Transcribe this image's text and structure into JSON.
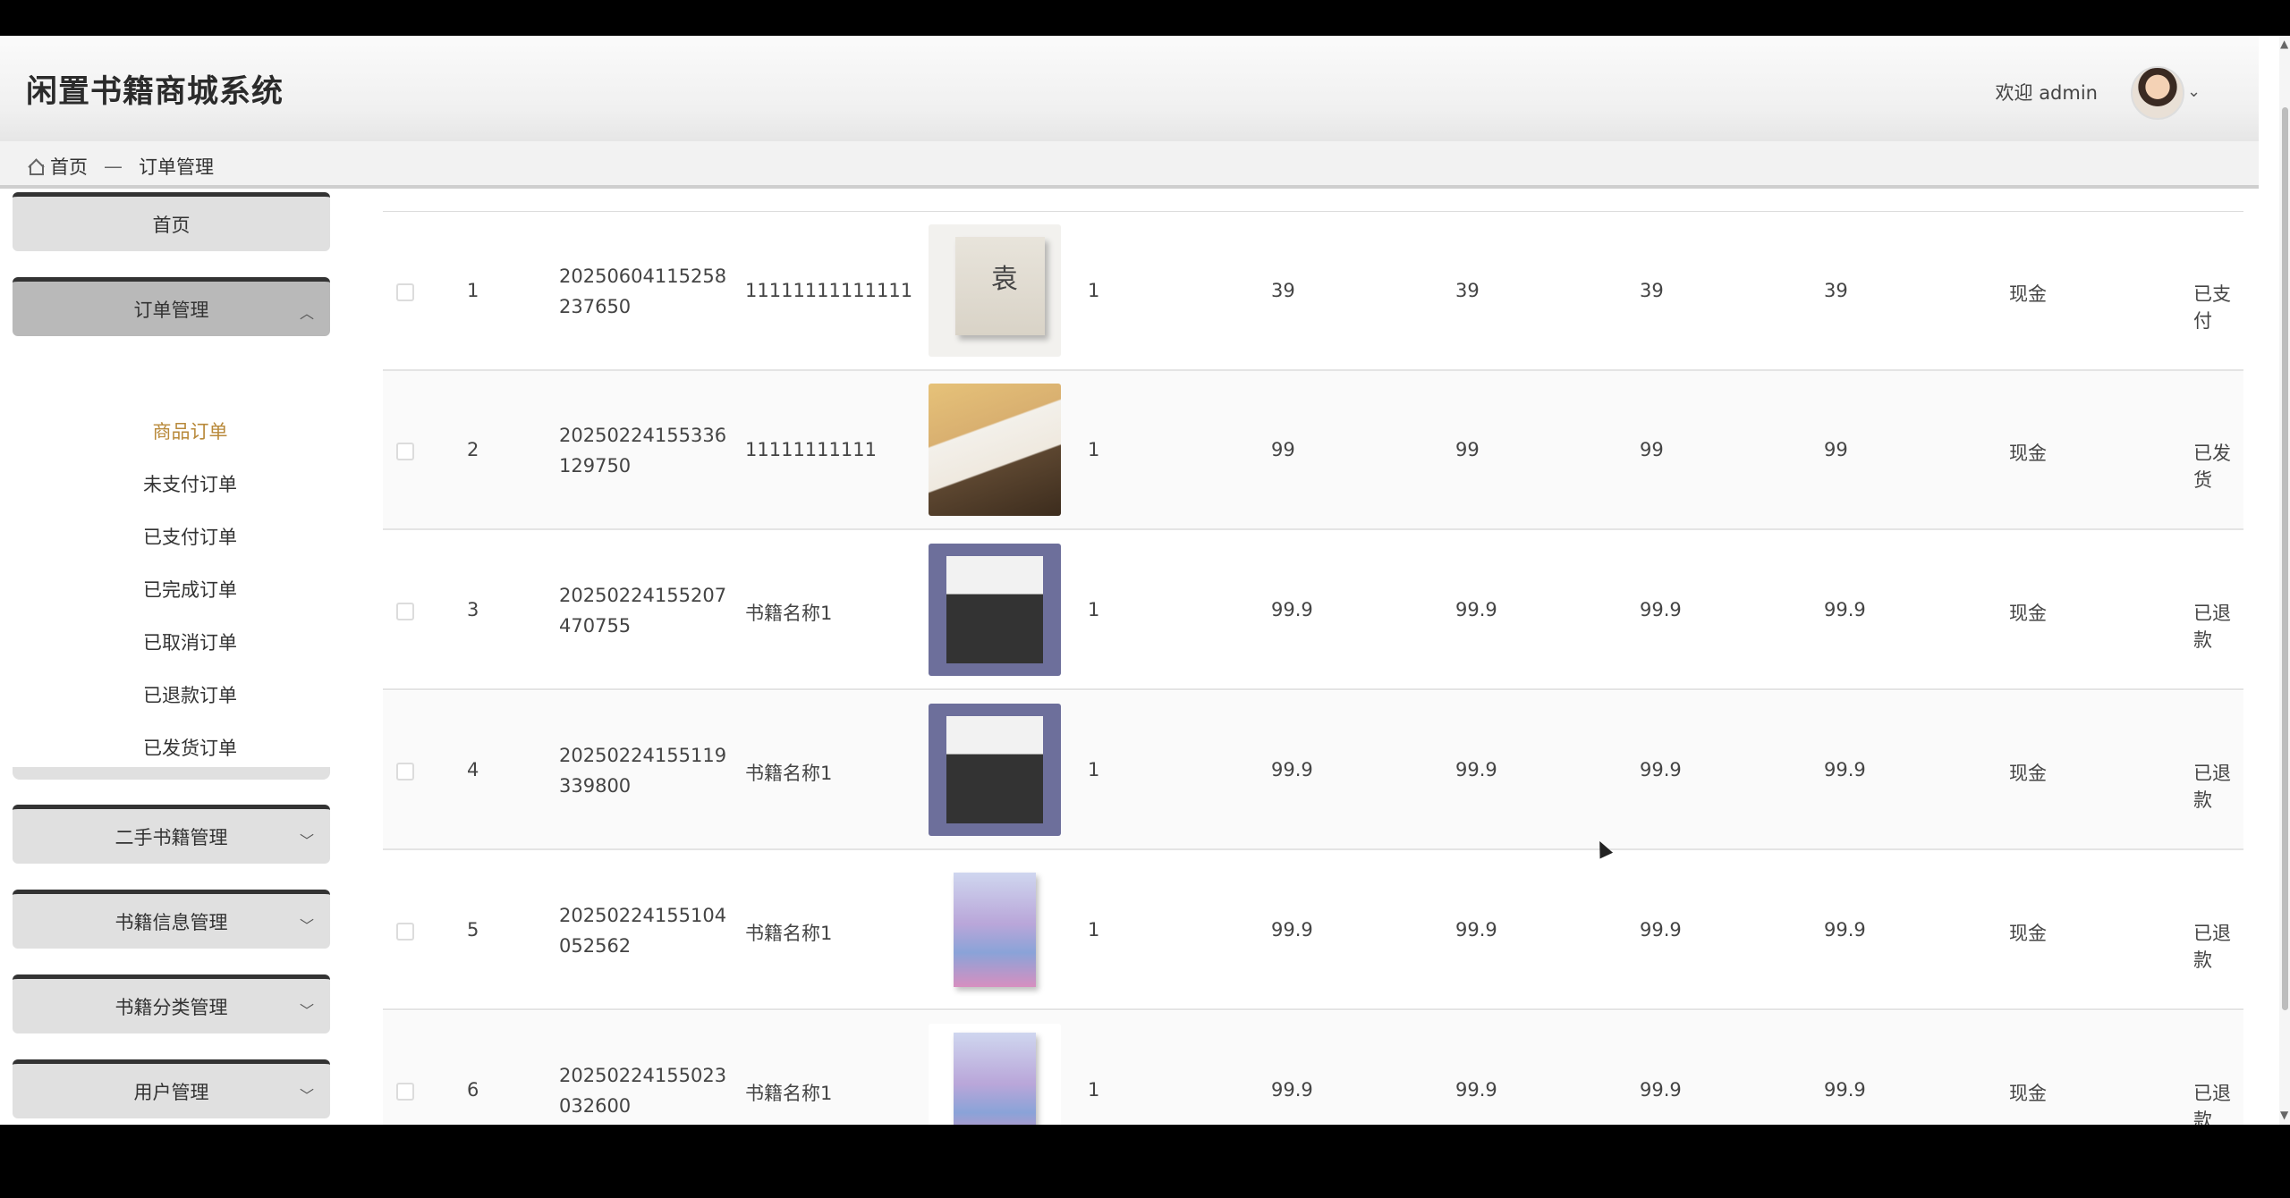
{
  "header": {
    "title": "闲置书籍商城系统",
    "welcome": "欢迎 admin"
  },
  "breadcrumb": {
    "home": "首页",
    "separator": "—",
    "current": "订单管理"
  },
  "sidebar": {
    "home": "首页",
    "order_mgmt": "订单管理",
    "order_sub": [
      "商品订单",
      "未支付订单",
      "已支付订单",
      "已完成订单",
      "已取消订单",
      "已退款订单",
      "已发货订单"
    ],
    "secondhand": "二手书籍管理",
    "book_info": "书籍信息管理",
    "book_category": "书籍分类管理",
    "users": "用户管理"
  },
  "table": {
    "rows": [
      {
        "idx": "1",
        "order_no": "20250604115258237650",
        "name": "11111111111111",
        "qty": "1",
        "price": "39",
        "pay_price": "39",
        "total": "39",
        "pay_total": "39",
        "pay_type": "现金",
        "status": "已支付"
      },
      {
        "idx": "2",
        "order_no": "20250224155336129750",
        "name": "11111111111",
        "qty": "1",
        "price": "99",
        "pay_price": "99",
        "total": "99",
        "pay_total": "99",
        "pay_type": "现金",
        "status": "已发货"
      },
      {
        "idx": "3",
        "order_no": "20250224155207470755",
        "name": "书籍名称1",
        "qty": "1",
        "price": "99.9",
        "pay_price": "99.9",
        "total": "99.9",
        "pay_total": "99.9",
        "pay_type": "现金",
        "status": "已退款"
      },
      {
        "idx": "4",
        "order_no": "20250224155119339800",
        "name": "书籍名称1",
        "qty": "1",
        "price": "99.9",
        "pay_price": "99.9",
        "total": "99.9",
        "pay_total": "99.9",
        "pay_type": "现金",
        "status": "已退款"
      },
      {
        "idx": "5",
        "order_no": "20250224155104052562",
        "name": "书籍名称1",
        "qty": "1",
        "price": "99.9",
        "pay_price": "99.9",
        "total": "99.9",
        "pay_total": "99.9",
        "pay_type": "现金",
        "status": "已退款"
      },
      {
        "idx": "6",
        "order_no": "20250224155023032600",
        "name": "书籍名称1",
        "qty": "1",
        "price": "99.9",
        "pay_price": "99.9",
        "total": "99.9",
        "pay_total": "99.9",
        "pay_type": "现金",
        "status": "已退款"
      }
    ]
  }
}
